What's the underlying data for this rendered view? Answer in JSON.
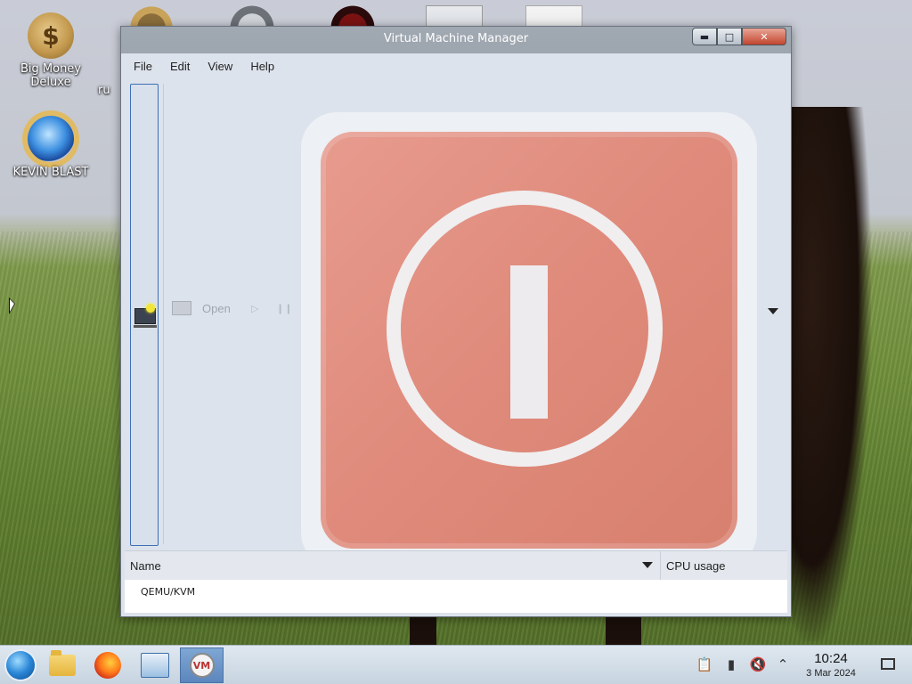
{
  "desktop": {
    "icons": [
      {
        "label_line1": "Big Money",
        "label_line2": "Deluxe",
        "icon": "money-bag-icon"
      },
      {
        "label_line1": "KEVIN BLAST",
        "label_line2": "",
        "icon": "sun-globe-icon"
      }
    ],
    "partial_label": "ru"
  },
  "window": {
    "title": "Virtual Machine Manager",
    "menu": [
      "File",
      "Edit",
      "View",
      "Help"
    ],
    "toolbar": {
      "open_label": "Open"
    },
    "list": {
      "columns": {
        "name": "Name",
        "cpu": "CPU usage"
      },
      "rows": [
        "QEMU/KVM"
      ]
    },
    "overlay_icon": "shutdown-power-icon"
  },
  "taskbar": {
    "items": [
      "start-orb-icon",
      "file-manager-icon",
      "firefox-icon",
      "control-panel-icon",
      "virt-manager-icon"
    ],
    "tray_icons": [
      "clipboard-icon",
      "battery-icon",
      "volume-muted-icon",
      "chevron-up-icon"
    ],
    "clock": {
      "time": "10:24",
      "date": "3 Mar 2024"
    }
  },
  "colors": {
    "close_button": "#c2452e",
    "active_task": "#5c86bd",
    "shutdown_tile": "#df8a7b"
  }
}
